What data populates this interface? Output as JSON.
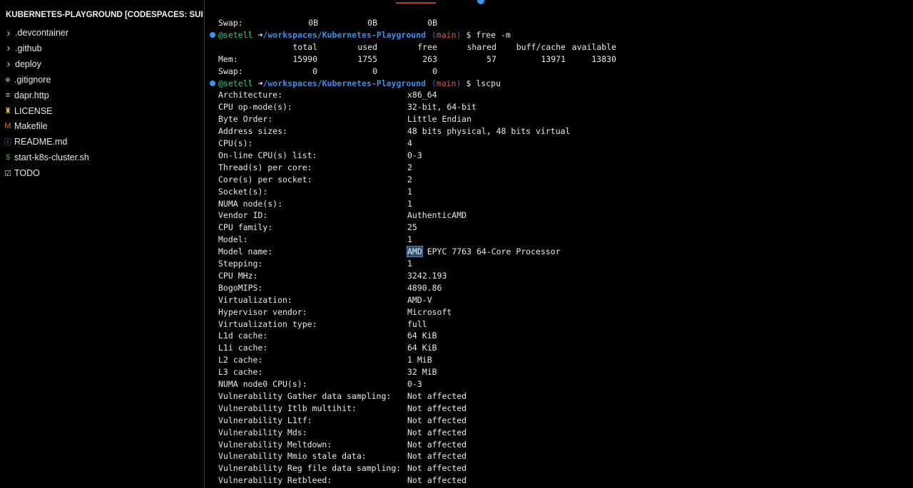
{
  "explorer": {
    "title": "KUBERNETES-PLAYGROUND [CODESPACES: SUPER ...",
    "items": [
      {
        "label": ".devcontainer",
        "kind": "folder",
        "icon": "chevron-right-icon",
        "glyph": "›",
        "color": "#c8c8c8"
      },
      {
        "label": ".github",
        "kind": "folder",
        "icon": "chevron-right-icon",
        "glyph": "›",
        "color": "#c8c8c8"
      },
      {
        "label": "deploy",
        "kind": "folder",
        "icon": "chevron-right-icon",
        "glyph": "›",
        "color": "#c8c8c8"
      },
      {
        "label": ".gitignore",
        "kind": "file",
        "icon": "git-file-icon",
        "glyph": "◈",
        "color": "#8c8c8c"
      },
      {
        "label": "dapr.http",
        "kind": "file",
        "icon": "http-file-icon",
        "glyph": "≡",
        "color": "#d0d0d0"
      },
      {
        "label": "LICENSE",
        "kind": "file",
        "icon": "license-icon",
        "glyph": "♜",
        "color": "#e2c044"
      },
      {
        "label": "Makefile",
        "kind": "file",
        "icon": "makefile-icon",
        "glyph": "M",
        "color": "#e37933"
      },
      {
        "label": "README.md",
        "kind": "file",
        "icon": "info-icon",
        "glyph": "ⓘ",
        "color": "#519aba"
      },
      {
        "label": "start-k8s-cluster.sh",
        "kind": "file",
        "icon": "shell-script-icon",
        "glyph": "$",
        "color": "#4d9e4d"
      },
      {
        "label": "TODO",
        "kind": "file",
        "icon": "checkbox-icon",
        "glyph": "☑",
        "color": "#d0d0d0"
      }
    ]
  },
  "terminal": {
    "prompt": {
      "user": "@setell",
      "arrow": "➜",
      "path": "/workspaces/Kubernetes-Playground",
      "branch_open": "(",
      "branch": "main",
      "branch_close": ")",
      "dollar": "$"
    },
    "prev_swap": {
      "label": "Swap:",
      "values": [
        "0B",
        "0B",
        "0B"
      ]
    },
    "free_command": "free -m",
    "free_table": {
      "headers": [
        "total",
        "used",
        "free",
        "shared",
        "buff/cache",
        "available"
      ],
      "rows": [
        {
          "label": "Mem:",
          "values": [
            "15990",
            "1755",
            "263",
            "57",
            "13971",
            "13830"
          ]
        },
        {
          "label": "Swap:",
          "values": [
            "0",
            "0",
            "0"
          ]
        }
      ]
    },
    "lscpu_command": "lscpu",
    "lscpu": [
      {
        "key": "Architecture:",
        "value": "x86_64"
      },
      {
        "key": "CPU op-mode(s):",
        "value": "32-bit, 64-bit"
      },
      {
        "key": "Byte Order:",
        "value": "Little Endian"
      },
      {
        "key": "Address sizes:",
        "value": "48 bits physical, 48 bits virtual"
      },
      {
        "key": "CPU(s):",
        "value": "4"
      },
      {
        "key": "On-line CPU(s) list:",
        "value": "0-3"
      },
      {
        "key": "Thread(s) per core:",
        "value": "2"
      },
      {
        "key": "Core(s) per socket:",
        "value": "2"
      },
      {
        "key": "Socket(s):",
        "value": "1"
      },
      {
        "key": "NUMA node(s):",
        "value": "1"
      },
      {
        "key": "Vendor ID:",
        "value": "AuthenticAMD"
      },
      {
        "key": "CPU family:",
        "value": "25"
      },
      {
        "key": "Model:",
        "value": "1"
      },
      {
        "key": "Model name:",
        "value": "AMD EPYC 7763 64-Core Processor",
        "selected": "AMD",
        "rest": " EPYC 7763 64-Core Processor"
      },
      {
        "key": "Stepping:",
        "value": "1"
      },
      {
        "key": "CPU MHz:",
        "value": "3242.193"
      },
      {
        "key": "BogoMIPS:",
        "value": "4890.86"
      },
      {
        "key": "Virtualization:",
        "value": "AMD-V"
      },
      {
        "key": "Hypervisor vendor:",
        "value": "Microsoft"
      },
      {
        "key": "Virtualization type:",
        "value": "full"
      },
      {
        "key": "L1d cache:",
        "value": "64 KiB"
      },
      {
        "key": "L1i cache:",
        "value": "64 KiB"
      },
      {
        "key": "L2 cache:",
        "value": "1 MiB"
      },
      {
        "key": "L3 cache:",
        "value": "32 MiB"
      },
      {
        "key": "NUMA node0 CPU(s):",
        "value": "0-3"
      },
      {
        "key": "Vulnerability Gather data sampling:",
        "value": "Not affected"
      },
      {
        "key": "Vulnerability Itlb multihit:",
        "value": "Not affected"
      },
      {
        "key": "Vulnerability L1tf:",
        "value": "Not affected"
      },
      {
        "key": "Vulnerability Mds:",
        "value": "Not affected"
      },
      {
        "key": "Vulnerability Meltdown:",
        "value": "Not affected"
      },
      {
        "key": "Vulnerability Mmio stale data:",
        "value": "Not affected"
      },
      {
        "key": "Vulnerability Reg file data sampling:",
        "value": "Not affected"
      },
      {
        "key": "Vulnerability Retbleed:",
        "value": "Not affected"
      }
    ]
  },
  "colors": {
    "background": "#000000",
    "prompt_user": "#23d18b",
    "prompt_path": "#3b8eea",
    "prompt_branch": "#e5534b",
    "selection": "#264f78",
    "accent_dot": "#3794ff"
  }
}
